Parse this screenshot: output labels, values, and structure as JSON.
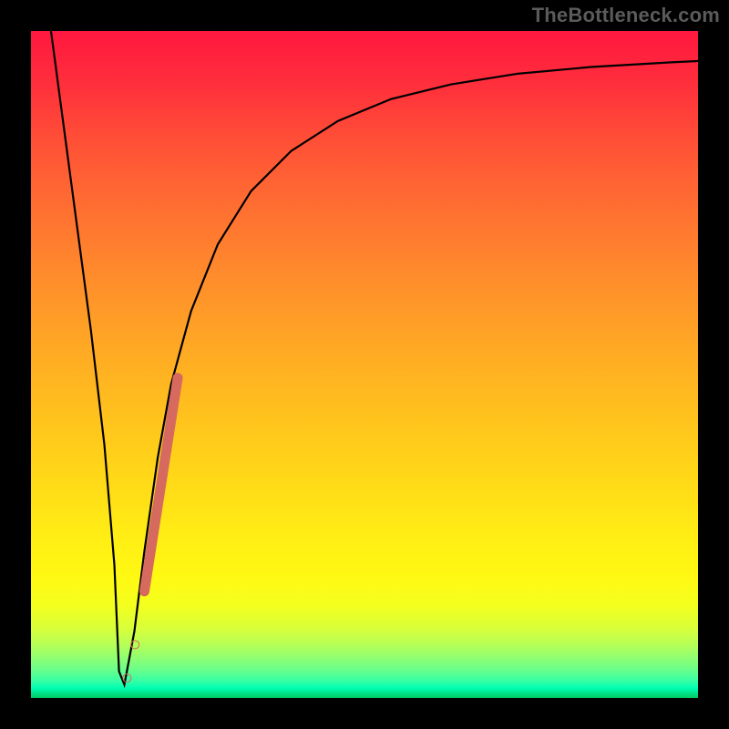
{
  "watermark": "TheBottleneck.com",
  "chart_data": {
    "type": "line",
    "title": "",
    "xlabel": "",
    "ylabel": "",
    "xlim": [
      0,
      100
    ],
    "ylim": [
      0,
      100
    ],
    "grid": false,
    "series": [
      {
        "name": "curve",
        "x": [
          3,
          5,
          7,
          9,
          11,
          12.5,
          13.2,
          14,
          15.5,
          17,
          19,
          21,
          24,
          28,
          33,
          39,
          46,
          54,
          63,
          73,
          84,
          96,
          100
        ],
        "y": [
          100,
          85,
          70,
          55,
          38,
          20,
          4,
          2,
          10,
          22,
          36,
          47,
          58,
          68,
          76,
          82,
          86.5,
          89.8,
          92,
          93.6,
          94.6,
          95.3,
          95.5
        ]
      }
    ],
    "markers": [
      {
        "name": "dot-lower",
        "x": 14.4,
        "y": 3.0,
        "size": 4.5
      },
      {
        "name": "dot-upper",
        "x": 15.6,
        "y": 8.0,
        "size": 4.5
      },
      {
        "name": "streak",
        "x1": 17.0,
        "y1": 16.0,
        "x2": 22.0,
        "y2": 48.0,
        "width": 11
      }
    ],
    "colors": {
      "curve": "#000000",
      "marker": "#d66a5e",
      "gradient_top": "#ff173f",
      "gradient_bottom": "#00c95f"
    }
  }
}
